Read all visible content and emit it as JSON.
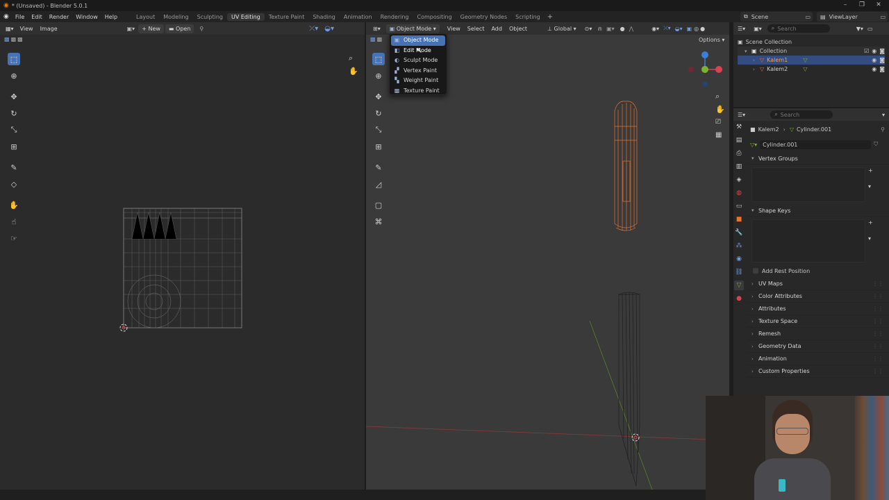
{
  "window": {
    "title": "* (Unsaved) - Blender 5.0.1",
    "minimize": "–",
    "restore": "❐",
    "close": "✕"
  },
  "menubar": {
    "items": [
      "File",
      "Edit",
      "Render",
      "Window",
      "Help"
    ],
    "workspaces": [
      "Layout",
      "Modeling",
      "Sculpting",
      "UV Editing",
      "Texture Paint",
      "Shading",
      "Animation",
      "Rendering",
      "Compositing",
      "Geometry Nodes",
      "Scripting"
    ],
    "active_workspace": "UV Editing",
    "add_workspace": "+",
    "scene": "Scene",
    "view_layer": "ViewLayer"
  },
  "uv_editor": {
    "menu_view": "View",
    "menu_image": "Image",
    "new_label": "New",
    "open_label": "Open"
  },
  "viewport": {
    "mode_button": "Object Mode",
    "menus": [
      "View",
      "Select",
      "Add",
      "Object"
    ],
    "transform_orientation": "Global",
    "options_label": "Options",
    "axis_x": "X",
    "axis_y": "Y",
    "axis_z": "Z"
  },
  "mode_dropdown": {
    "items": [
      {
        "label": "Object Mode",
        "icon": "object-mode-icon",
        "glyph": "▣"
      },
      {
        "label": "Edit Mode",
        "icon": "edit-mode-icon",
        "glyph": "◧"
      },
      {
        "label": "Sculpt Mode",
        "icon": "sculpt-mode-icon",
        "glyph": "◐"
      },
      {
        "label": "Vertex Paint",
        "icon": "vertex-paint-icon",
        "glyph": "▞"
      },
      {
        "label": "Weight Paint",
        "icon": "weight-paint-icon",
        "glyph": "▚"
      },
      {
        "label": "Texture Paint",
        "icon": "texture-paint-icon",
        "glyph": "▩"
      }
    ],
    "selected": "Object Mode",
    "hovered": "Edit Mode"
  },
  "outliner": {
    "search_placeholder": "Search",
    "scene_collection": "Scene Collection",
    "collection": "Collection",
    "objects": [
      {
        "name": "Kalem1",
        "selected": true
      },
      {
        "name": "Kalem2",
        "selected": false
      }
    ]
  },
  "properties": {
    "search_placeholder": "Search",
    "breadcrumb_object": "Kalem2",
    "breadcrumb_mesh": "Cylinder.001",
    "mesh_name": "Cylinder.001",
    "sections": {
      "vertex_groups": "Vertex Groups",
      "shape_keys": "Shape Keys",
      "add_rest_position": "Add Rest Position",
      "collapsed": [
        "UV Maps",
        "Color Attributes",
        "Attributes",
        "Texture Space",
        "Remesh",
        "Geometry Data",
        "Animation",
        "Custom Properties"
      ]
    }
  },
  "colors": {
    "accent": "#4772b3",
    "selected_object": "#e8712c",
    "axis_x": "#d9434f",
    "axis_y": "#7fb32c",
    "axis_z": "#3b7fd6"
  }
}
